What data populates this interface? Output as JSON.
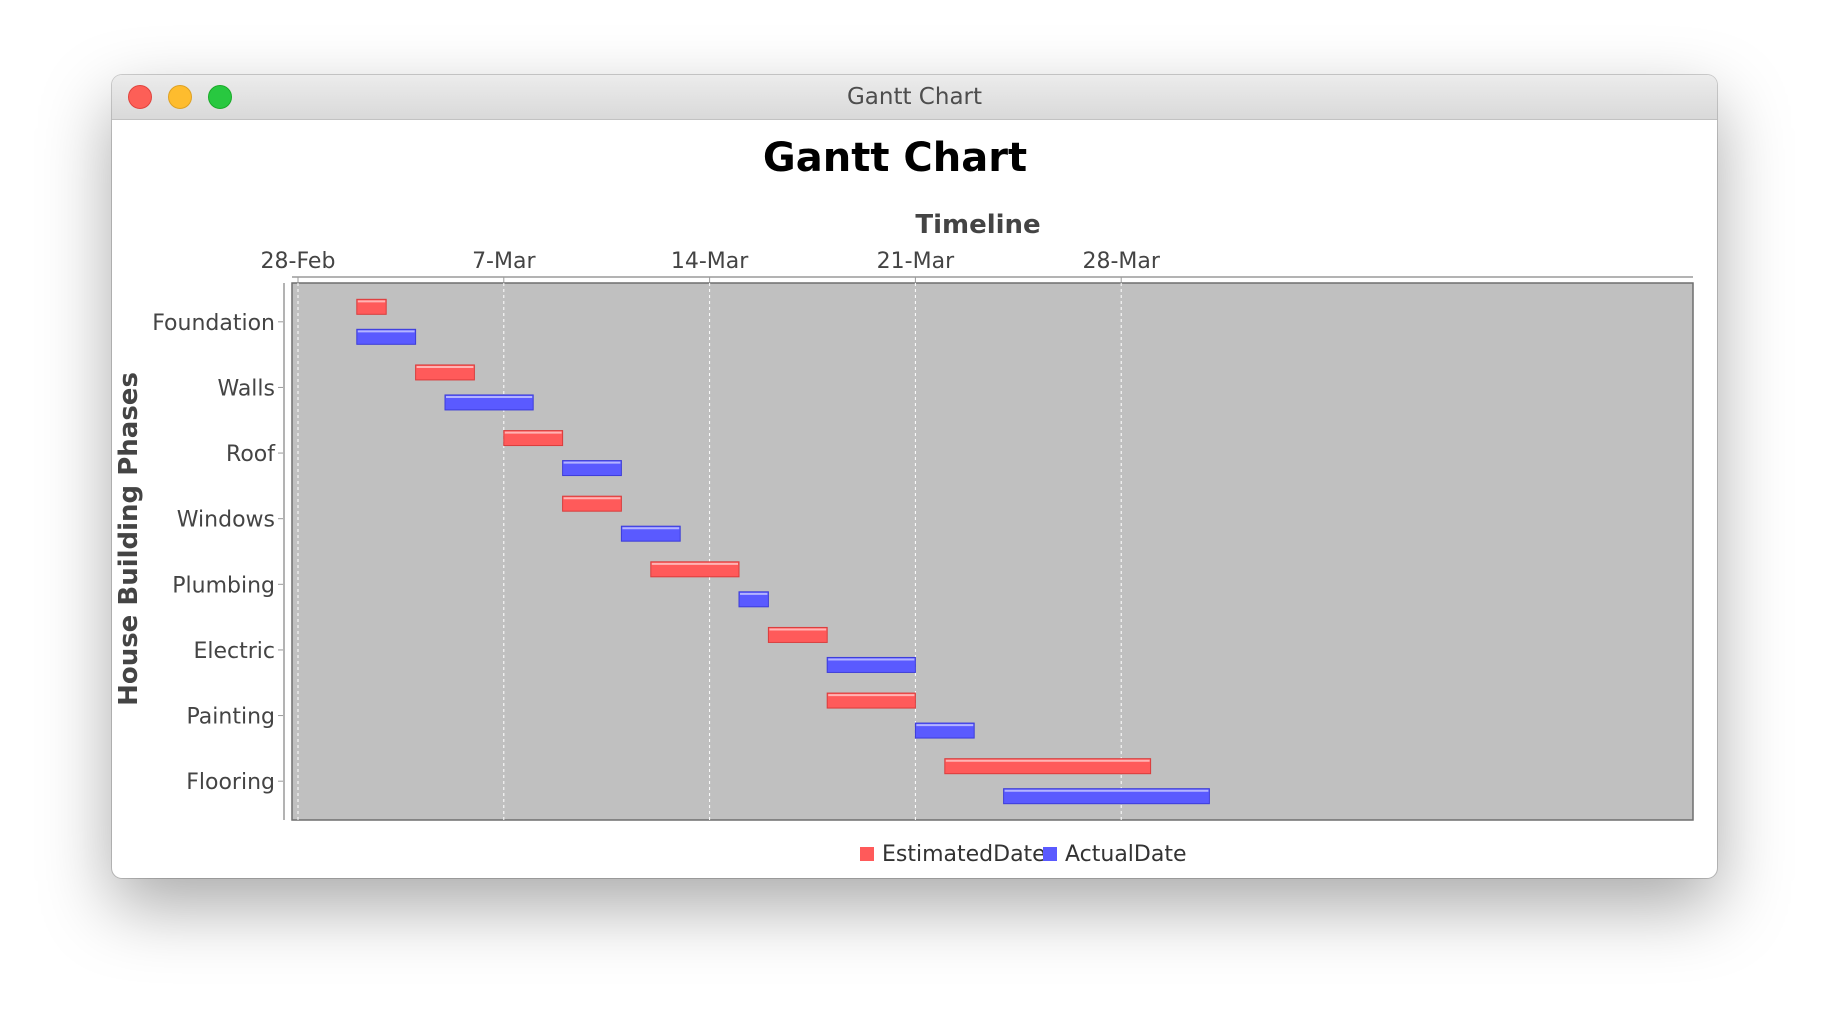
{
  "window": {
    "title": "Gantt Chart"
  },
  "chart_data": {
    "type": "gantt",
    "title": "Gantt Chart",
    "xlabel": "Timeline",
    "ylabel": "House Building Phases",
    "x_ticks": [
      "28-Feb",
      "7-Mar",
      "14-Mar",
      "21-Mar",
      "28-Mar"
    ],
    "xlim": [
      "2024-02-28",
      "2024-03-31"
    ],
    "categories": [
      "Foundation",
      "Walls",
      "Roof",
      "Windows",
      "Plumbing",
      "Electric",
      "Painting",
      "Flooring"
    ],
    "series": [
      {
        "name": "EstimatedDate",
        "color": "#ff5a5a",
        "tasks": [
          {
            "task": "Foundation",
            "start": "2024-03-01",
            "end": "2024-03-02"
          },
          {
            "task": "Walls",
            "start": "2024-03-03",
            "end": "2024-03-05"
          },
          {
            "task": "Roof",
            "start": "2024-03-06",
            "end": "2024-03-08"
          },
          {
            "task": "Windows",
            "start": "2024-03-08",
            "end": "2024-03-10"
          },
          {
            "task": "Plumbing",
            "start": "2024-03-11",
            "end": "2024-03-14"
          },
          {
            "task": "Electric",
            "start": "2024-03-15",
            "end": "2024-03-17"
          },
          {
            "task": "Painting",
            "start": "2024-03-17",
            "end": "2024-03-20"
          },
          {
            "task": "Flooring",
            "start": "2024-03-21",
            "end": "2024-03-28"
          }
        ]
      },
      {
        "name": "ActualDate",
        "color": "#5a5aff",
        "tasks": [
          {
            "task": "Foundation",
            "start": "2024-03-01",
            "end": "2024-03-03"
          },
          {
            "task": "Walls",
            "start": "2024-03-04",
            "end": "2024-03-07"
          },
          {
            "task": "Roof",
            "start": "2024-03-08",
            "end": "2024-03-10"
          },
          {
            "task": "Windows",
            "start": "2024-03-10",
            "end": "2024-03-12"
          },
          {
            "task": "Plumbing",
            "start": "2024-03-14",
            "end": "2024-03-15"
          },
          {
            "task": "Electric",
            "start": "2024-03-17",
            "end": "2024-03-20"
          },
          {
            "task": "Painting",
            "start": "2024-03-20",
            "end": "2024-03-22"
          },
          {
            "task": "Flooring",
            "start": "2024-03-23",
            "end": "2024-03-30"
          }
        ]
      }
    ],
    "grid": true,
    "legend": "bottom",
    "plot_background": "#c0c0c0"
  }
}
